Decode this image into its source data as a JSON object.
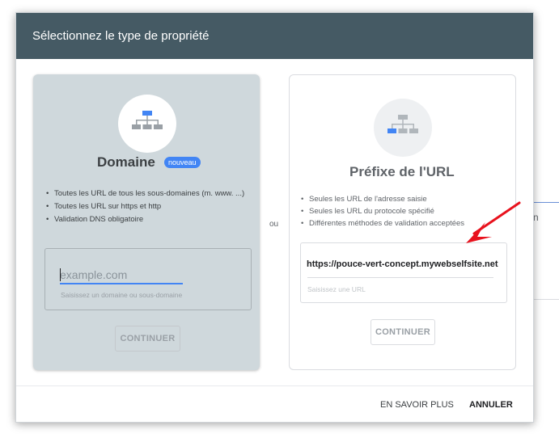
{
  "dialog": {
    "title": "Sélectionnez le type de propriété",
    "separator": "ou"
  },
  "domain_card": {
    "icon": "sitemap-icon",
    "title": "Domaine",
    "badge": "nouveau",
    "bullets": [
      "Toutes les URL de tous les sous-domaines (m. www. ...)",
      "Toutes les URL sur https et http",
      "Validation DNS obligatoire"
    ],
    "input_placeholder": "example.com",
    "input_value": "",
    "helper": "Saisissez un domaine ou sous-domaine",
    "continue_label": "CONTINUER"
  },
  "prefix_card": {
    "icon": "sitemap-icon",
    "title": "Préfixe de l'URL",
    "bullets": [
      "Seules les URL de l'adresse saisie",
      "Seules les URL du protocole spécifié",
      "Différentes méthodes de validation acceptées"
    ],
    "input_value": "https://pouce-vert-concept.mywebselfsite.net",
    "helper": "Saisissez une URL",
    "continue_label": "CONTINUER"
  },
  "footer": {
    "learn_more": "EN SAVOIR PLUS",
    "cancel": "ANNULER"
  },
  "background": {
    "edge_text": "n"
  },
  "colors": {
    "header": "#455a64",
    "domain_card": "#cfd8dc",
    "accent": "#4285f4",
    "annotation_arrow": "#e8121d"
  }
}
